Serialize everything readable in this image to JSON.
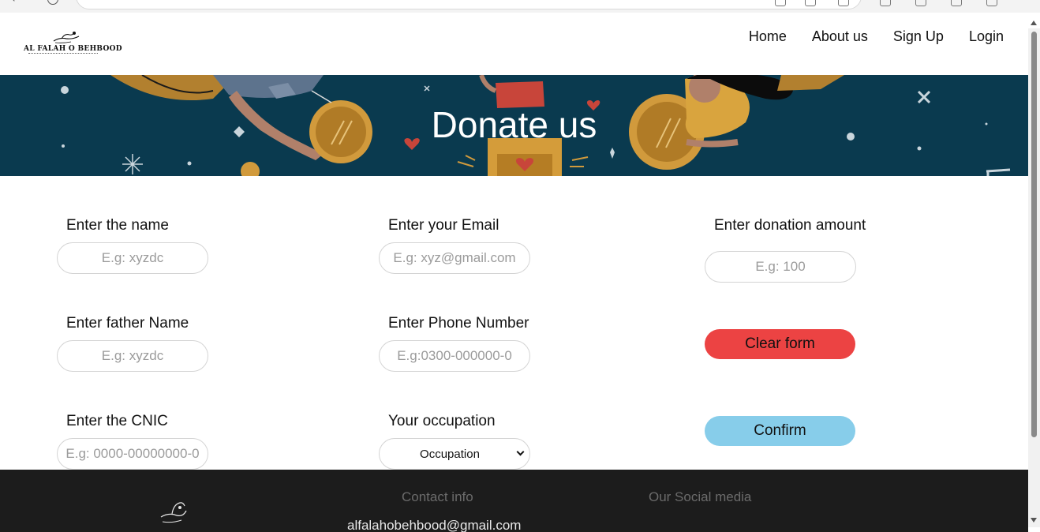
{
  "header": {
    "logo_text": "AL FALAH O BEHBOOD",
    "nav": [
      "Home",
      "About us",
      "Sign Up",
      "Login"
    ]
  },
  "hero": {
    "title": "Donate us"
  },
  "form": {
    "name": {
      "label": "Enter the name",
      "placeholder": "E.g: xyzdc"
    },
    "email": {
      "label": "Enter your Email",
      "placeholder": "E.g: xyz@gmail.com"
    },
    "amount": {
      "label": "Enter donation amount",
      "placeholder": "E.g: 100"
    },
    "father_name": {
      "label": "Enter father Name",
      "placeholder": "E.g: xyzdc"
    },
    "phone": {
      "label": "Enter Phone Number",
      "placeholder": "E.g:0300-000000-0"
    },
    "cnic": {
      "label": "Enter the CNIC",
      "placeholder": "E.g: 0000-00000000-0"
    },
    "occupation": {
      "label": "Your occupation",
      "selected": "Occupation"
    },
    "clear_label": "Clear form",
    "confirm_label": "Confirm"
  },
  "footer": {
    "contact_title": "Contact info",
    "email": "alfalahobehbood@gmail.com",
    "social_title": "Our Social media"
  },
  "colors": {
    "hero_bg": "#0a3a4f",
    "clear_button": "#ec4343",
    "confirm_button": "#87cdea",
    "footer_bg": "#1c1c1c"
  }
}
